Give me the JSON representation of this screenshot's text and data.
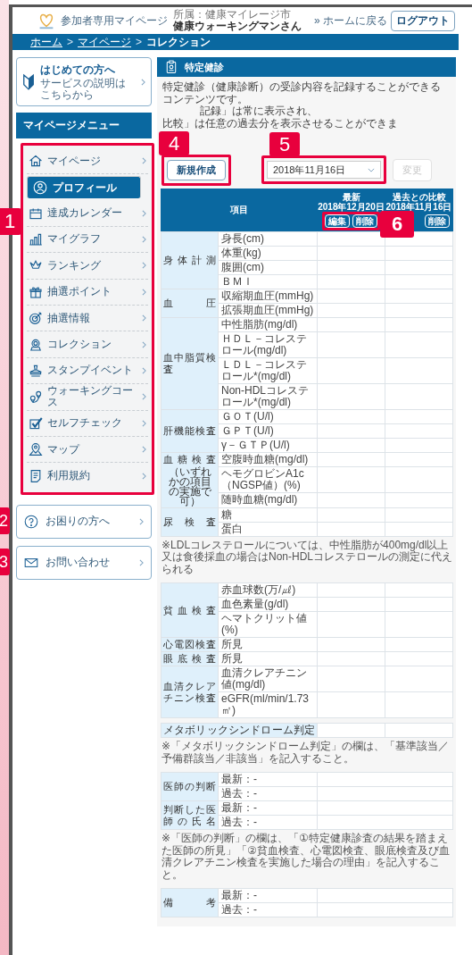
{
  "header": {
    "site_title": "参加者専用マイページ",
    "affiliation": "所属：健康マイレージ市",
    "user_name": "健康ウォーキングマンさん",
    "home_link": "» ホームに戻る",
    "logout_button": "ログアウト"
  },
  "breadcrumb": {
    "separator": ">",
    "items": [
      {
        "label": "ホーム",
        "current": false
      },
      {
        "label": "マイページ",
        "current": false
      },
      {
        "label": "コレクション",
        "current": true
      }
    ]
  },
  "sidebar": {
    "intro": {
      "title": "はじめての方へ",
      "subtitle": "サービスの説明はこちらから"
    },
    "menu_title": "マイページメニュー",
    "menu_callout": "1",
    "menu": [
      {
        "label": "マイページ",
        "selected": false
      },
      {
        "label": "プロフィール",
        "selected": true
      },
      {
        "label": "達成カレンダー",
        "selected": false
      },
      {
        "label": "マイグラフ",
        "selected": false
      },
      {
        "label": "ランキング",
        "selected": false
      },
      {
        "label": "抽選ポイント",
        "selected": false
      },
      {
        "label": "抽選情報",
        "selected": false
      },
      {
        "label": "コレクション",
        "selected": false
      },
      {
        "label": "スタンプイベント",
        "selected": false
      },
      {
        "label": "ウォーキングコース",
        "selected": false
      },
      {
        "label": "セルフチェック",
        "selected": false
      },
      {
        "label": "マップ",
        "selected": false
      },
      {
        "label": "利用規約",
        "selected": false
      }
    ],
    "help": {
      "label": "お困りの方へ",
      "callout": "2"
    },
    "contact": {
      "label": "お問い合わせ",
      "callout": "3"
    }
  },
  "main": {
    "title": "特定健診",
    "description": "特定健診（健康診断）の受診内容を記録することができるコンテンツです。",
    "description_fragments": [
      "記録」は常に表示され、",
      "比較」は任意の過去分を表示させることができま"
    ],
    "new_button": {
      "label": "新規作成",
      "callout": "4"
    },
    "date_select": {
      "value": "2018年11月16日",
      "callout": "5"
    },
    "change_button": {
      "label": "変更",
      "disabled": true
    },
    "table_header": {
      "callout": "6",
      "columns": [
        {
          "label": "項目"
        },
        {
          "label": "最新",
          "date": "2018年12月20日",
          "buttons": [
            "編集",
            "削除"
          ]
        },
        {
          "label": "過去との比較",
          "date": "2018年11月16日",
          "buttons": [
            "削除"
          ]
        }
      ]
    },
    "blocks": [
      {
        "kind": "grouped",
        "groups": [
          {
            "label": "身体計測",
            "items": [
              "身長(cm)",
              "体重(kg)",
              "腹囲(cm)",
              "ＢＭＩ"
            ]
          },
          {
            "label": "血圧",
            "items": [
              "収縮期血圧(mmHg)",
              "拡張期血圧(mmHg)"
            ]
          },
          {
            "label": "血中脂質検査",
            "items": [
              "中性脂肪(mg/dl)",
              "ＨＤＬ－コレステロール(mg/dl)",
              "ＬＤＬ－コレステロール*(mg/dl)",
              "Non-HDLコレステロール*(mg/dl)"
            ]
          },
          {
            "label": "肝機能検査",
            "items": [
              "ＧＯＴ(U/l)",
              "ＧＰＴ(U/l)",
              "γ－ＧＴＰ(U/l)"
            ]
          },
          {
            "label": "血糖検査",
            "note": "（いずれかの項目の実施で可）",
            "items": [
              "空腹時血糖(mg/dl)",
              "ヘモグロビンA1c（NGSP値）(%)",
              "随時血糖(mg/dl)"
            ]
          },
          {
            "label": "尿検査",
            "items": [
              "糖",
              "蛋白"
            ]
          }
        ]
      },
      {
        "kind": "note",
        "text": "※LDLコレステロールについては、中性脂肪が400mg/dl以上又は食後採血の場合はNon-HDLコレステロールの測定に代えられる"
      },
      {
        "kind": "grouped",
        "groups": [
          {
            "label": "貧血検査",
            "items": [
              "赤血球数(万/㎕)",
              "血色素量(g/dl)",
              "ヘマトクリット値(%)"
            ]
          },
          {
            "label": "心電図検査",
            "items": [
              "所見"
            ]
          },
          {
            "label": "眼底検査",
            "items": [
              "所見"
            ]
          },
          {
            "label": "血清クレアチニン検査",
            "items": [
              "血清クレアチニン値(mg/dl)",
              "eGFR(ml/min/1.73㎡)"
            ]
          }
        ]
      },
      {
        "kind": "single",
        "label": "メタボリックシンドローム判定"
      },
      {
        "kind": "note",
        "text": "※「メタボリックシンドローム判定」の欄は、「基準該当／予備群該当／非該当」を記入すること。"
      },
      {
        "kind": "remarks",
        "groups": [
          {
            "label": "医師の判断",
            "items": [
              "最新：-",
              "過去：-"
            ]
          },
          {
            "label": "判断した医師の氏名",
            "items": [
              "最新：-",
              "過去：-"
            ]
          }
        ]
      },
      {
        "kind": "note",
        "text": "※「医師の判断」の欄は、「①特定健康診査の結果を踏まえた医師の所見」「②貧血検査、心電図検査、眼底検査及び血清クレアチニン検査を実施した場合の理由」を記入すること。"
      },
      {
        "kind": "remarks",
        "groups": [
          {
            "label": "備考",
            "items": [
              "最新：-",
              "過去：-"
            ]
          }
        ]
      }
    ]
  }
}
